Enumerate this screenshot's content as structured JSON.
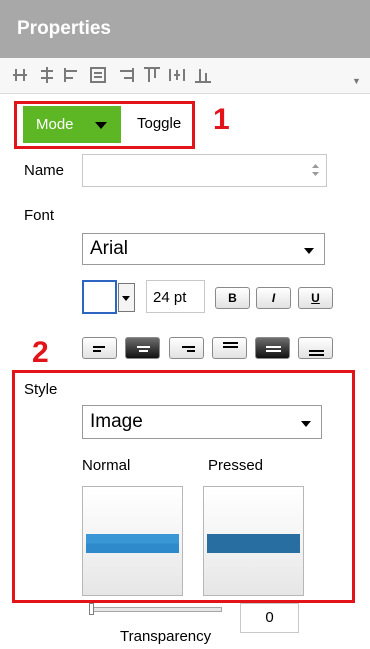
{
  "panel": {
    "title": "Properties"
  },
  "callouts": {
    "first": "1",
    "second": "2"
  },
  "mode": {
    "label": "Mode",
    "toggle_label": "Toggle",
    "color": "#5db623"
  },
  "name": {
    "label": "Name",
    "value": ""
  },
  "font": {
    "label": "Font",
    "family": "Arial",
    "size": "24 pt",
    "bold": "B",
    "italic": "I",
    "underline": "U"
  },
  "style": {
    "label": "Style",
    "value": "Image",
    "normal_label": "Normal",
    "pressed_label": "Pressed",
    "normal_color": "#3a97d6",
    "pressed_color": "#286ea0"
  },
  "transparency": {
    "label": "Transparency",
    "value": "0"
  },
  "accent_color": "#e3131a"
}
